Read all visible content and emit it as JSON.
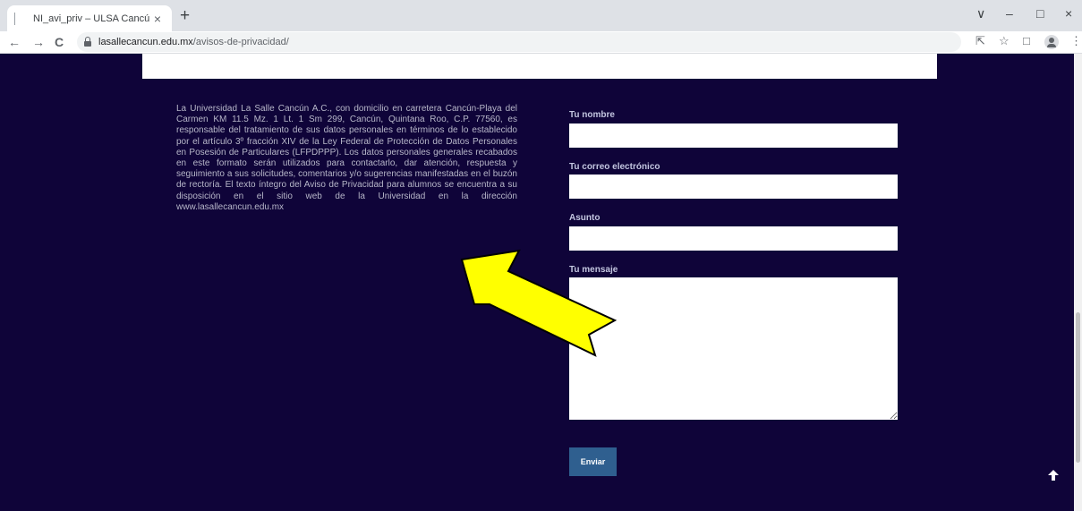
{
  "browser": {
    "tab_title": "NI_avi_priv – ULSA Cancún",
    "tab_close": "×",
    "new_tab": "+",
    "url_host": "lasallecancun.edu.mx",
    "url_path": "/avisos-de-privacidad/",
    "back": "←",
    "forward": "→",
    "reload": "C",
    "share": "⇱",
    "bookmark": "☆",
    "sidebar": "□",
    "menu": "⋮",
    "win_down": "∨",
    "win_min": "–",
    "win_restore": "□",
    "win_close": "×"
  },
  "privacy_text": "La Universidad La Salle Cancún A.C., con domicilio en carretera Cancún-Playa del Carmen KM 11.5 Mz. 1 Lt. 1 Sm 299, Cancún, Quintana Roo, C.P. 77560, es responsable del tratamiento de sus datos personales en términos de lo establecido por el artículo 3º fracción XIV de la Ley Federal de Protección de Datos Personales en Posesión de Particulares (LFPDPPP). Los datos personales generales recabados en este formato serán utilizados para contactarlo, dar atención, respuesta y seguimiento a sus solicitudes, comentarios y/o sugerencias manifestadas en el buzón de rectoría. El texto íntegro del Aviso de Privacidad para alumnos se encuentra a su disposición en el sitio web de la Universidad en la dirección www.lasallecancun.edu.mx",
  "form": {
    "name_label": "Tu nombre",
    "email_label": "Tu correo electrónico",
    "subject_label": "Asunto",
    "message_label": "Tu mensaje",
    "submit_label": "Enviar"
  },
  "colors": {
    "page_bg": "#0f0439",
    "button_bg": "#2f5f8f",
    "arrow_fill": "#ffff00"
  }
}
